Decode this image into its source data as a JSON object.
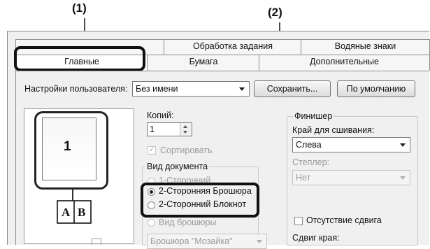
{
  "callouts": {
    "c1": "(1)",
    "c2": "(2)"
  },
  "tabs_back": [
    "Обработка задания",
    "Водяные знаки"
  ],
  "tabs_front": [
    "Главные",
    "Бумага",
    "Дополнительные"
  ],
  "user_settings": {
    "label": "Настройки пользователя:",
    "value": "Без имени",
    "save_label": "Сохранить...",
    "default_label": "По умолчанию"
  },
  "preview": {
    "page_number": "1",
    "book_left": "A",
    "book_right": "B"
  },
  "copies": {
    "label": "Копий:",
    "value": "1"
  },
  "collate": {
    "label": "Сортировать",
    "checked": true
  },
  "document_style": {
    "title": "Вид документа",
    "options": [
      "1-Сторонний",
      "2-Сторонняя Брошюра",
      "2-Сторонний Блокнот",
      "Вид брошюры"
    ],
    "selected": "2-Сторонняя Брошюра"
  },
  "booklet": {
    "value": "Брошюра \"Мозайка\""
  },
  "finisher": {
    "title": "Финишер",
    "binding_label": "Край для сшивания:",
    "binding_value": "Слева",
    "staple_label": "Степлер:",
    "staple_value": "Нет",
    "no_offset_label": "Отсутствие сдвига",
    "margin_shift_label": "Сдвиг края:"
  }
}
